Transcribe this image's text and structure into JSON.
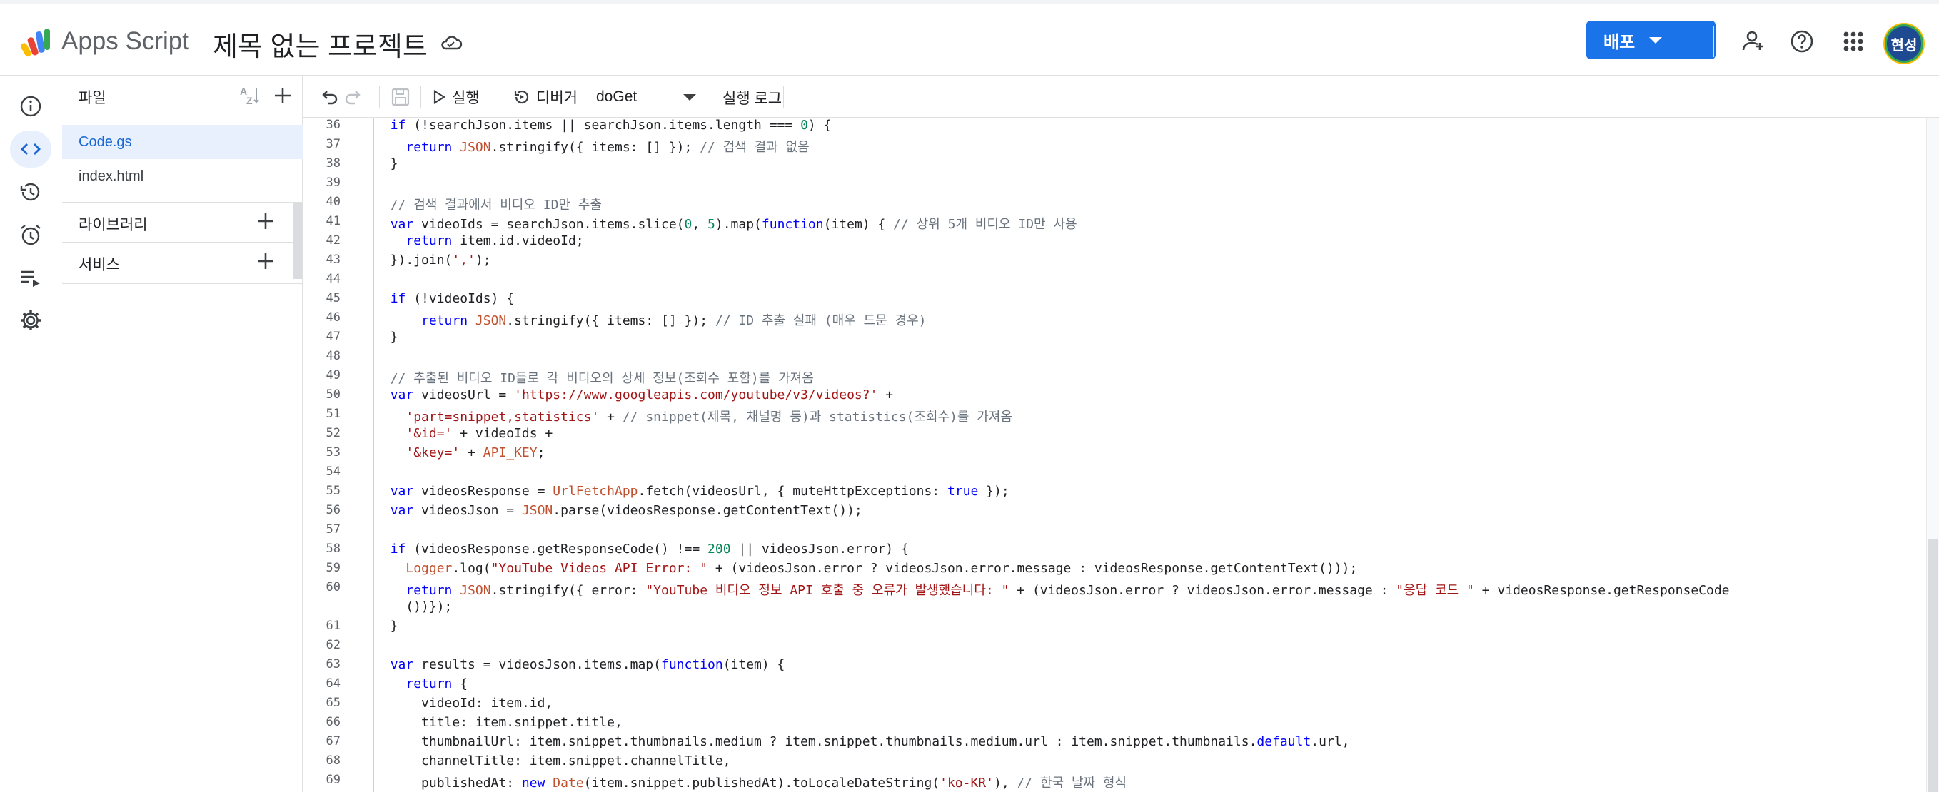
{
  "header": {
    "app_name": "Apps Script",
    "project_title": "제목 없는 프로젝트",
    "deploy_label": "배포",
    "avatar_text": "현성"
  },
  "left_nav": {
    "items": [
      {
        "name": "overview",
        "icon": "info-icon"
      },
      {
        "name": "editor",
        "icon": "code-icon",
        "active": true
      },
      {
        "name": "versions",
        "icon": "history-icon"
      },
      {
        "name": "triggers",
        "icon": "alarm-icon"
      },
      {
        "name": "executions",
        "icon": "list-play-icon"
      },
      {
        "name": "settings",
        "icon": "gear-icon"
      }
    ]
  },
  "files_panel": {
    "title": "파일",
    "files": [
      "Code.gs",
      "index.html"
    ],
    "libraries_label": "라이브러리",
    "services_label": "서비스"
  },
  "toolbar": {
    "run_label": "실행",
    "debug_label": "디버거",
    "function_name": "doGet",
    "log_label": "실행 로그"
  },
  "editor": {
    "line_numbers": [
      "36",
      "37",
      "38",
      "39",
      "40",
      "41",
      "42",
      "43",
      "44",
      "45",
      "46",
      "47",
      "48",
      "49",
      "50",
      "51",
      "52",
      "53",
      "54",
      "55",
      "56",
      "57",
      "58",
      "59",
      "60",
      "",
      "61",
      "62",
      "63",
      "64",
      "65",
      "66",
      "67",
      "68",
      "69"
    ]
  },
  "colors": {
    "accent": "#1a73e8",
    "active_bg": "#e8f0fe",
    "keyword": "#0000ff",
    "string": "#a31515",
    "number": "#098658",
    "comment": "#6a737d"
  }
}
